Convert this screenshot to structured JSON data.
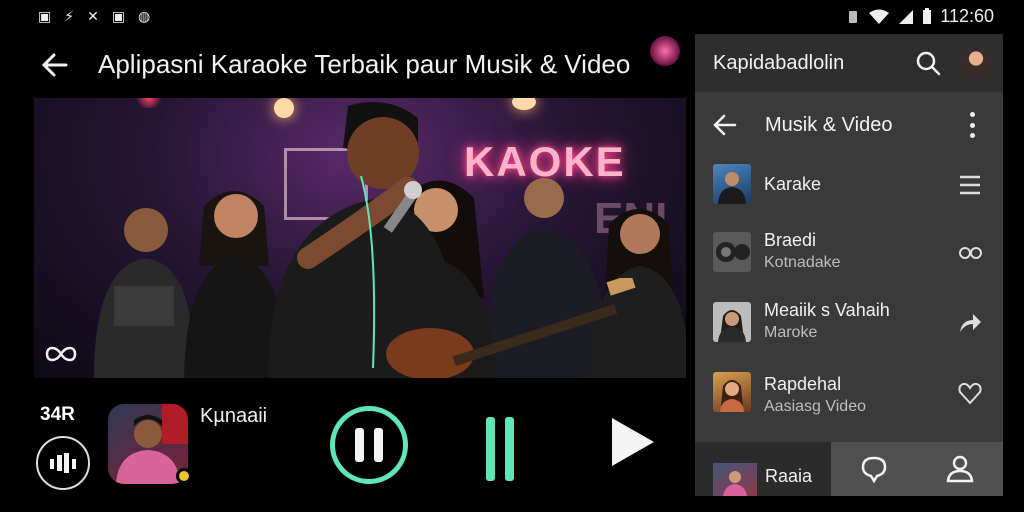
{
  "status_bar": {
    "left_icons": [
      "▣",
      "⚡",
      "✕",
      "▣",
      "◍"
    ],
    "time": "112:60"
  },
  "header": {
    "title": "Aplipasni Karaoke Terbaik paur Musik & Video",
    "back_icon": "arrow-left-icon"
  },
  "video": {
    "sign_text": "KAOKE",
    "sign_text_2": "ENI"
  },
  "player": {
    "queue_count": "34R",
    "now_playing_title": "Kµnaaii",
    "accent": "#5ee6b8"
  },
  "panel": {
    "account_name": "Kapidabadlolin",
    "section_title": "Musik & Video",
    "items": [
      {
        "title": "Karake",
        "subtitle": "",
        "action_icon": "menu-lines-icon"
      },
      {
        "title": "Braedi",
        "subtitle": "Kotnadake",
        "action_icon": "speaker-icon"
      },
      {
        "title": "Meaiik s Vahaih",
        "subtitle": "Maroke",
        "action_icon": "share-arrow-icon"
      },
      {
        "title": "Rapdehal",
        "subtitle": "Aasiasg Video",
        "action_icon": "heart-icon"
      }
    ],
    "bottom_nav": {
      "label": "Raaia"
    }
  }
}
